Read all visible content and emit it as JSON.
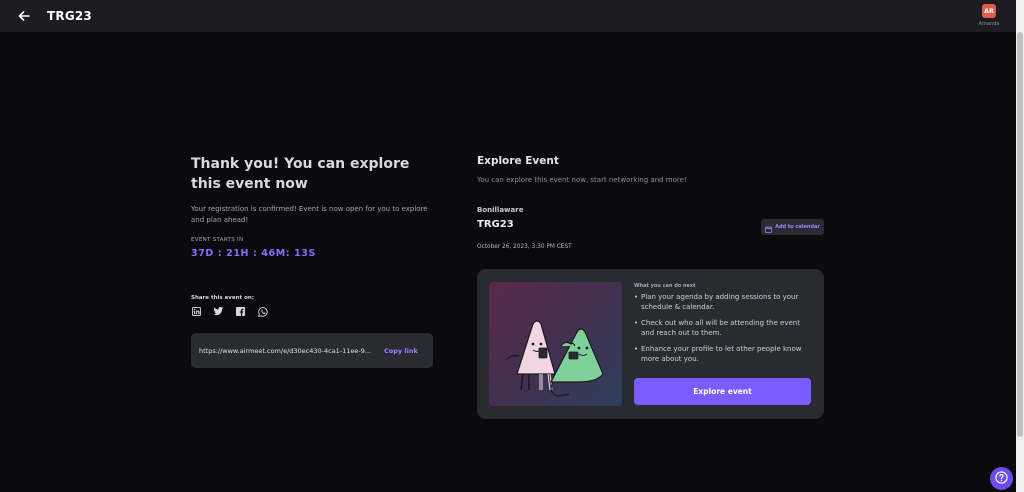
{
  "header": {
    "title": "TRG23",
    "avatar_initials": "AR",
    "avatar_name": "Amanda"
  },
  "left": {
    "heading": "Thank you! You can explore this event now",
    "subtext": "Your registration is confirmed! Event is now open for you to explore and plan ahead!",
    "starts_label": "EVENT STARTS IN",
    "countdown": "37D : 21H : 46M: 13S",
    "share_label": "Share this event on:",
    "socials": [
      "linkedin-icon",
      "twitter-icon",
      "facebook-icon",
      "whatsapp-icon"
    ],
    "link": "https://www.airmeet.com/e/d30ec430-4ca1-11ee-9...",
    "copy_label": "Copy link"
  },
  "right": {
    "title": "Explore Event",
    "subtitle": "You can explore this event now, start networking and more!",
    "organizer": "Bonillaware",
    "event_name": "TRG23",
    "date": "October 26, 2023, 3:30 PM CEST",
    "calendar_label": "Add to calendar",
    "next_label": "What you can do next",
    "bullets": [
      "Plan your agenda by adding sessions to your schedule & calendar.",
      "Check out who all will be attending the event and reach out to them.",
      "Enhance your profile to let other people know more about you."
    ],
    "explore_button": "Explore event"
  },
  "colors": {
    "accent": "#7b5cff",
    "countdown": "#8b6cff",
    "background": "#0b0b0d",
    "avatar": "#e15a4a"
  }
}
